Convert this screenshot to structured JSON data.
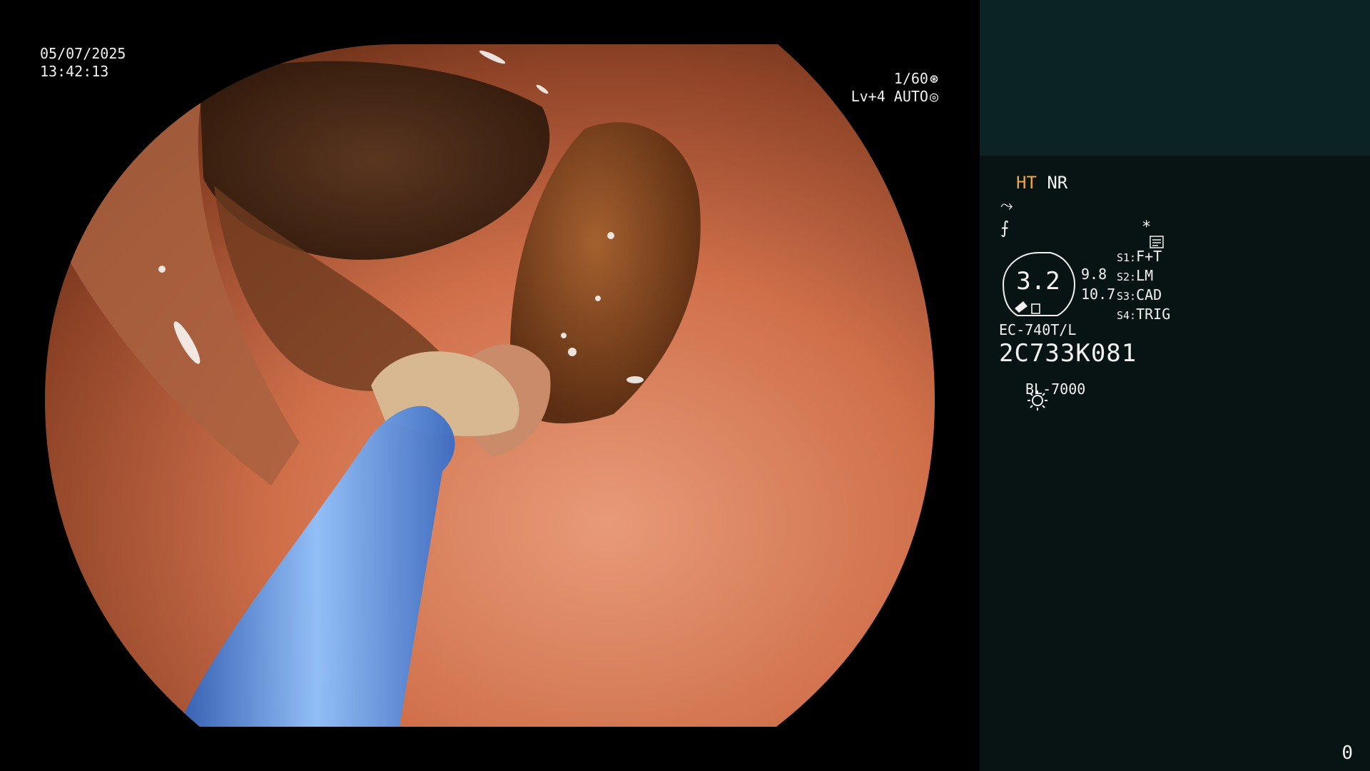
{
  "overlay": {
    "date": "05/07/2025",
    "time": "13:42:13",
    "shutter": "1/60",
    "shutter_icon": "aperture-icon",
    "level": "Lv+4 AUTO",
    "level_icon": "iris-icon"
  },
  "panel": {
    "mode_ht": "HT",
    "mode_nr": "NR",
    "icon_a": "⤳",
    "icon_b": "⨍",
    "zoom": "3.2",
    "scale_top": "9.8",
    "scale_bottom": "10.7",
    "scenes": [
      {
        "key": "S1:",
        "label": "F+T"
      },
      {
        "key": "S2:",
        "label": "LM"
      },
      {
        "key": "S3:",
        "label": "CAD"
      },
      {
        "key": "S4:",
        "label": "TRIG"
      }
    ],
    "scope_model": "EC-740T/L",
    "scope_serial": "2C733K081",
    "light_source": "BL-7000",
    "star": "*",
    "counter": "0"
  },
  "colors": {
    "panel_bg": "#081313",
    "thumb_bg": "#0c2325",
    "ht_accent": "#f0a83c",
    "osd_text": "#f0f0f0"
  }
}
